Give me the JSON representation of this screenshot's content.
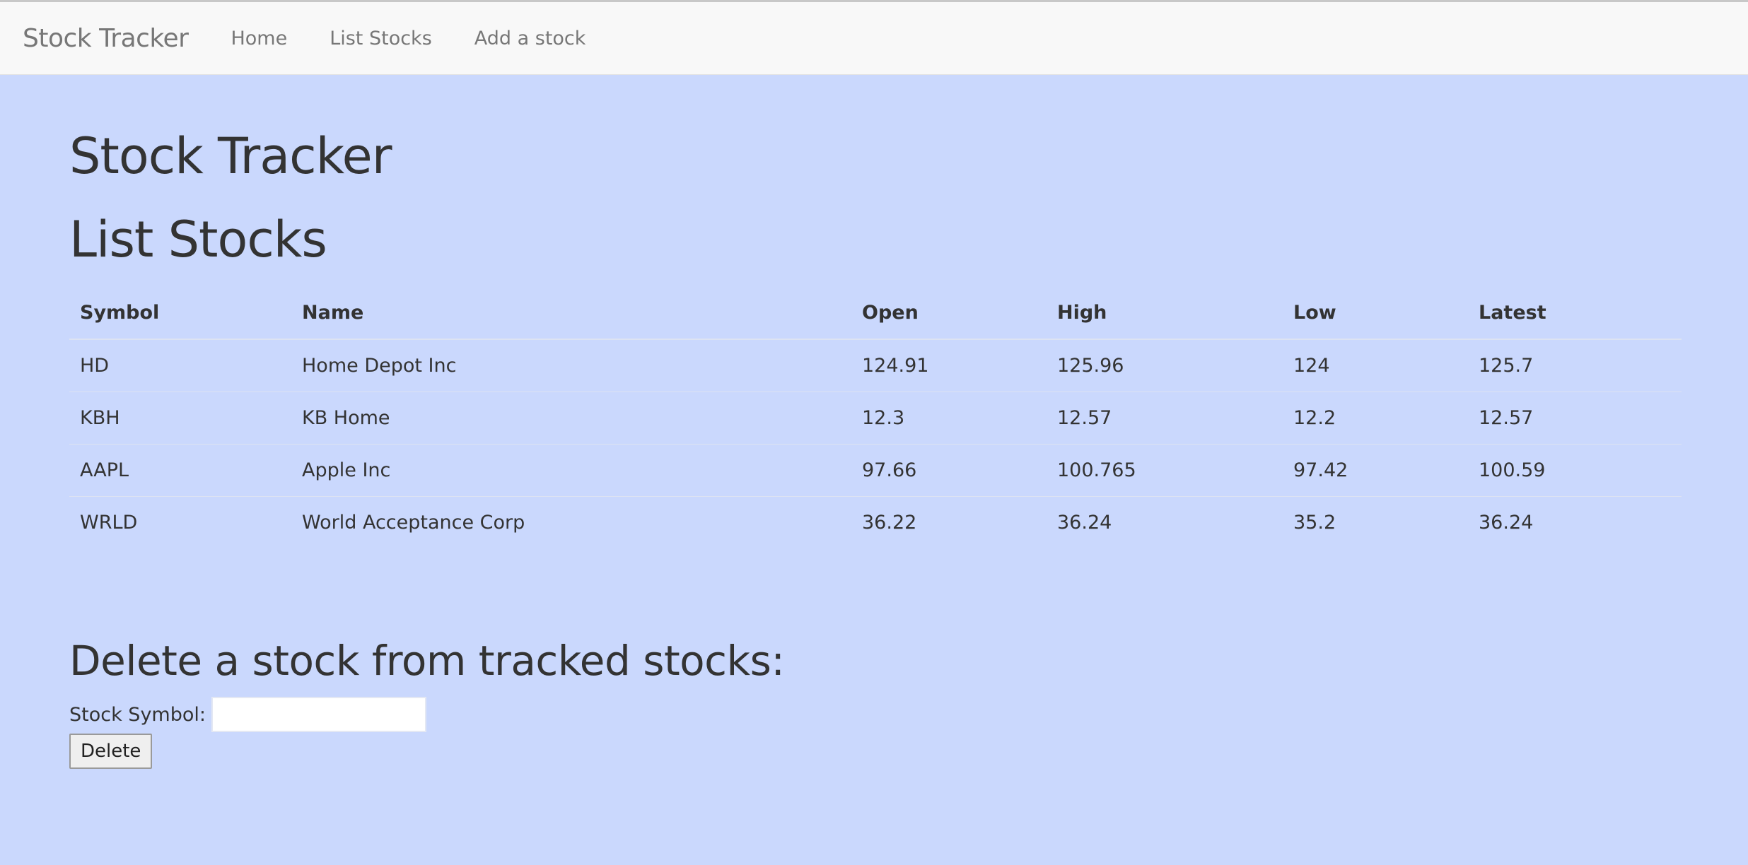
{
  "navbar": {
    "brand": "Stock Tracker",
    "links": [
      {
        "label": "Home"
      },
      {
        "label": "List Stocks"
      },
      {
        "label": "Add a stock"
      }
    ]
  },
  "main": {
    "site_title": "Stock Tracker",
    "list_title": "List Stocks",
    "table": {
      "headers": [
        "Symbol",
        "Name",
        "Open",
        "High",
        "Low",
        "Latest"
      ],
      "rows": [
        [
          "HD",
          "Home Depot Inc",
          "124.91",
          "125.96",
          "124",
          "125.7"
        ],
        [
          "KBH",
          "KB Home",
          "12.3",
          "12.57",
          "12.2",
          "12.57"
        ],
        [
          "AAPL",
          "Apple Inc",
          "97.66",
          "100.765",
          "97.42",
          "100.59"
        ],
        [
          "WRLD",
          "World Acceptance Corp",
          "36.22",
          "36.24",
          "35.2",
          "36.24"
        ]
      ]
    },
    "delete_form": {
      "heading": "Delete a stock from tracked stocks:",
      "symbol_label": "Stock Symbol:",
      "symbol_value": "",
      "button_label": "Delete"
    }
  },
  "colors": {
    "page_background": "#cad8fd",
    "navbar_background": "#f8f8f8",
    "nav_text": "#777777",
    "body_text": "#333333"
  }
}
